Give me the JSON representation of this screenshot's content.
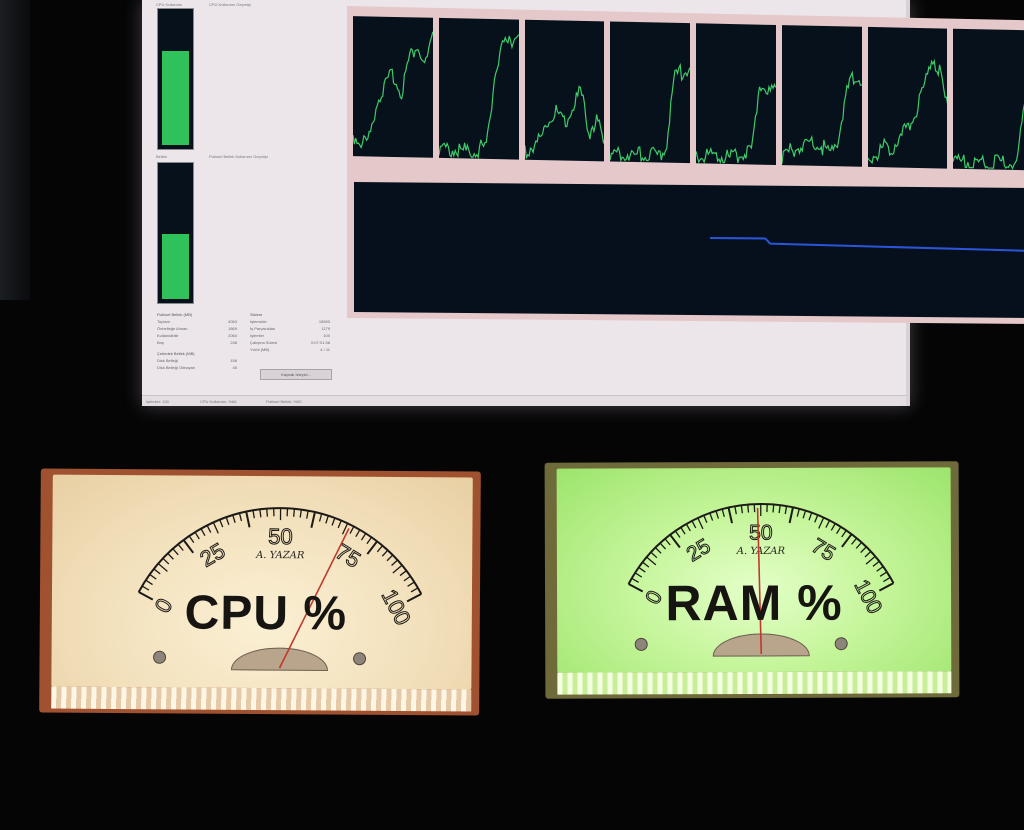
{
  "monitor": {
    "window": {
      "histogram_caption": "CPU Kullanımı Geçmişi",
      "cpu_bar_caption": "CPU Kullanımı",
      "ram_bar_caption": "Bellek",
      "memory_history_caption": "Fiziksel Bellek Kullanımı Geçmişi",
      "cpu_percent": 71,
      "ram_percent": 49,
      "cpu_value_text": "",
      "ram_value_text": "",
      "physical_memory": {
        "heading": "Fiziksel Bellek (MB)",
        "rows": [
          {
            "label": "Toplam",
            "value": "4063"
          },
          {
            "label": "Önbelleğe Alınan",
            "value": "1869"
          },
          {
            "label": "Kullanılabilir",
            "value": "2064"
          },
          {
            "label": "Boş",
            "value": "246"
          }
        ]
      },
      "kernel_memory": {
        "heading": "Çekirdek Bellek (MB)",
        "rows": [
          {
            "label": "Disk Belleği",
            "value": "156"
          },
          {
            "label": "Disk Belleği Olmayan",
            "value": "45"
          }
        ]
      },
      "system": {
        "heading": "Sistem",
        "rows": [
          {
            "label": "İşlemciler",
            "value": "15593"
          },
          {
            "label": "İş Parçacıkları",
            "value": "1179"
          },
          {
            "label": "İşlemler",
            "value": "100"
          },
          {
            "label": "Çalışma Süresi",
            "value": "0:07:01:38"
          },
          {
            "label": "Yürüt (MB)",
            "value": "4 / 11"
          }
        ]
      },
      "resource_monitor_button": "Kaynak İzleyici...",
      "status_bar": {
        "processes": "İşlemler: 100",
        "cpu_usage": "CPU Kullanımı: %66",
        "physical_memory": "Fiziksel Bellek: %50"
      }
    }
  },
  "meters": {
    "cpu": {
      "label": "CPU %",
      "needle_value": 71,
      "scale_labels": [
        "0",
        "25",
        "50",
        "75",
        "100"
      ],
      "signature": "A. YAZAR",
      "backlight": "#f2e0bb"
    },
    "ram": {
      "label": "RAM %",
      "needle_value": 49,
      "scale_labels": [
        "0",
        "25",
        "50",
        "75",
        "100"
      ],
      "signature": "A. YAZAR",
      "backlight": "#c5f59a"
    }
  },
  "colors": {
    "graph_bg": "#06111b",
    "cpu_trace": "#3ecb6a",
    "memory_trace": "#2a55d8",
    "bar_fill": "#2fc15a"
  }
}
